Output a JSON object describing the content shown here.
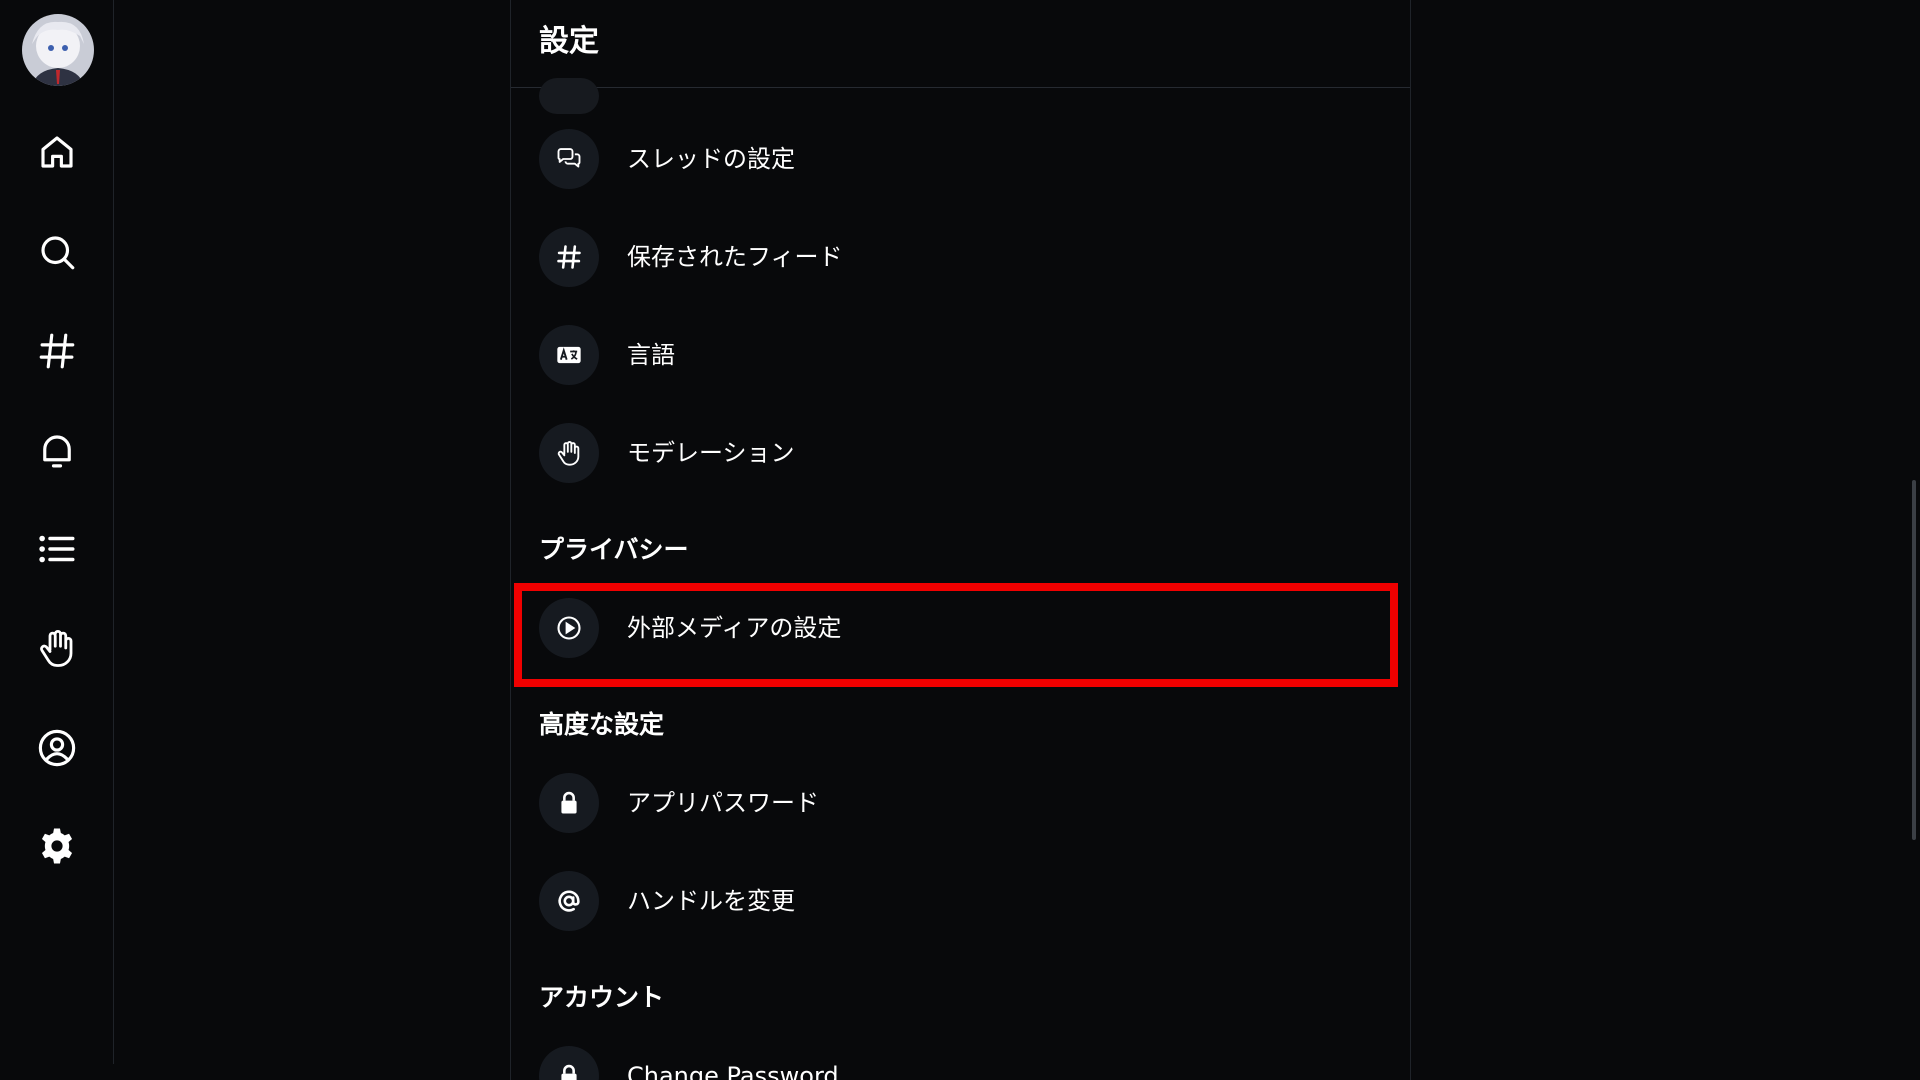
{
  "header": {
    "title": "設定"
  },
  "items": {
    "thread_settings": "スレッドの設定",
    "saved_feeds": "保存されたフィード",
    "languages": "言語",
    "moderation": "モデレーション",
    "external_media": "外部メディアの設定",
    "app_passwords": "アプリパスワード",
    "change_handle": "ハンドルを変更",
    "change_password": "Change Password"
  },
  "sections": {
    "privacy": "プライバシー",
    "advanced": "高度な設定",
    "account": "アカウント"
  },
  "nav": {
    "icons": [
      "home-icon",
      "search-icon",
      "hashtag-icon",
      "bell-icon",
      "list-icon",
      "hand-icon",
      "profile-icon",
      "gear-icon"
    ]
  },
  "colors": {
    "background": "#08090b",
    "icon_circle": "#161a20",
    "highlight": "#f00000",
    "text": "#ffffff"
  }
}
